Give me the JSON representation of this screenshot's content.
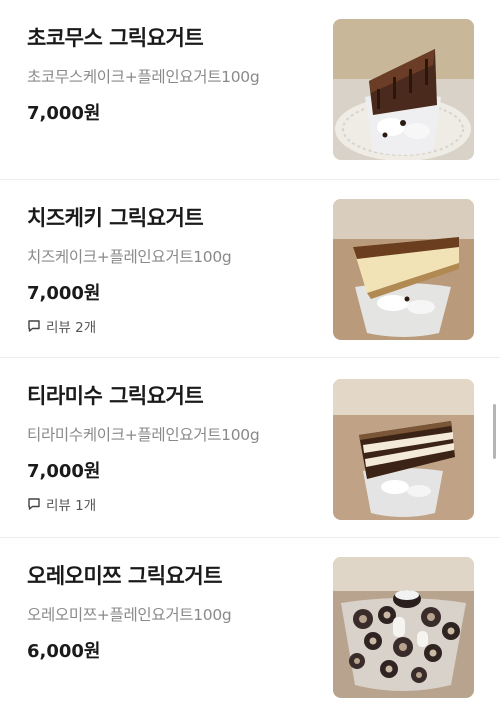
{
  "menu": {
    "items": [
      {
        "name": "초코무스 그릭요거트",
        "description": "초코무스케이크+플레인요거트100g",
        "price": "7,000원",
        "image_icon": "chocolate-mousse-yogurt-photo"
      },
      {
        "name": "치즈케키 그릭요거트",
        "description": "치즈케이크+플레인요거트100g",
        "price": "7,000원",
        "review": "리뷰 2개",
        "image_icon": "cheesecake-yogurt-photo"
      },
      {
        "name": "티라미수 그릭요거트",
        "description": "티라미수케이크+플레인요거트100g",
        "price": "7,000원",
        "review": "리뷰 1개",
        "image_icon": "tiramisu-yogurt-photo"
      },
      {
        "name": "오레오미쯔 그릭요거트",
        "description": "오레오미쯔+플레인요거트100g",
        "price": "6,000원",
        "image_icon": "oreo-yogurt-photo"
      }
    ]
  },
  "colors": {
    "text_primary": "#1a1a1a",
    "text_secondary": "#8a8a8a",
    "divider": "#ececec"
  }
}
